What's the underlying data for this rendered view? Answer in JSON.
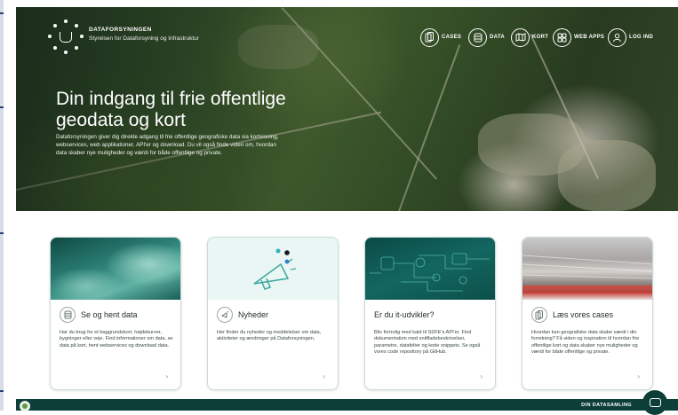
{
  "header": {
    "brand_name": "DATAFORSYNINGEN",
    "brand_sub": "Styrelsen for Dataforsyning og Infrastruktur",
    "nav": [
      {
        "label": "CASES",
        "icon": "phone-copy-icon"
      },
      {
        "label": "DATA",
        "icon": "database-icon"
      },
      {
        "label": "KORT",
        "icon": "map-icon"
      },
      {
        "label": "WEB APPS",
        "icon": "grid-apps-icon"
      },
      {
        "label": "LOG IND",
        "icon": "user-icon"
      }
    ]
  },
  "hero": {
    "title": "Din indgang til frie offentlige geodata og kort",
    "lead": "Dataforsyningen giver dig direkte adgang til frie offentlige geografiske data via kortvisning, webservices, web applikationer, API'er og download. Du vil også finde viden om, hvordan data skaber nye muligheder og værdi for både offentlige og private."
  },
  "cards": [
    {
      "title": "Se og hent data",
      "icon": "database-icon",
      "text": "Har du brug for et baggrundskort, højdekurver, bygninger eller veje. Find informationer om data, se data på kort, hent webservices og download data.",
      "arrow": "›"
    },
    {
      "title": "Nyheder",
      "icon": "megaphone-icon",
      "text": "Her finder du nyheder og meddelelser om data, aktiviteter og ændringer på Dataforsyningen.",
      "arrow": "›"
    },
    {
      "title": "Er du it-udvikler?",
      "icon": "",
      "text": "Bliv fortrolig med kald til SDFE's API'er. Find dokumentation med snitfladebeskrivelser, parametre, datafelter og kode snippets. Se også vores code repository på GitHub.",
      "arrow": "›"
    },
    {
      "title": "Læs vores cases",
      "icon": "phone-copy-icon",
      "text": "Hvordan kan geografiske data skabe værdi i din forretning? Få viden og inspiration til hvordan frie offentlige kort og data skaber nye muligheder og værdi for både offentlige og private.",
      "arrow": "›"
    }
  ],
  "footer": {
    "label": "DIN DATASAMLING"
  },
  "colors": {
    "brand_dark": "#0d3f38",
    "card_border": "#c9dcd6"
  }
}
